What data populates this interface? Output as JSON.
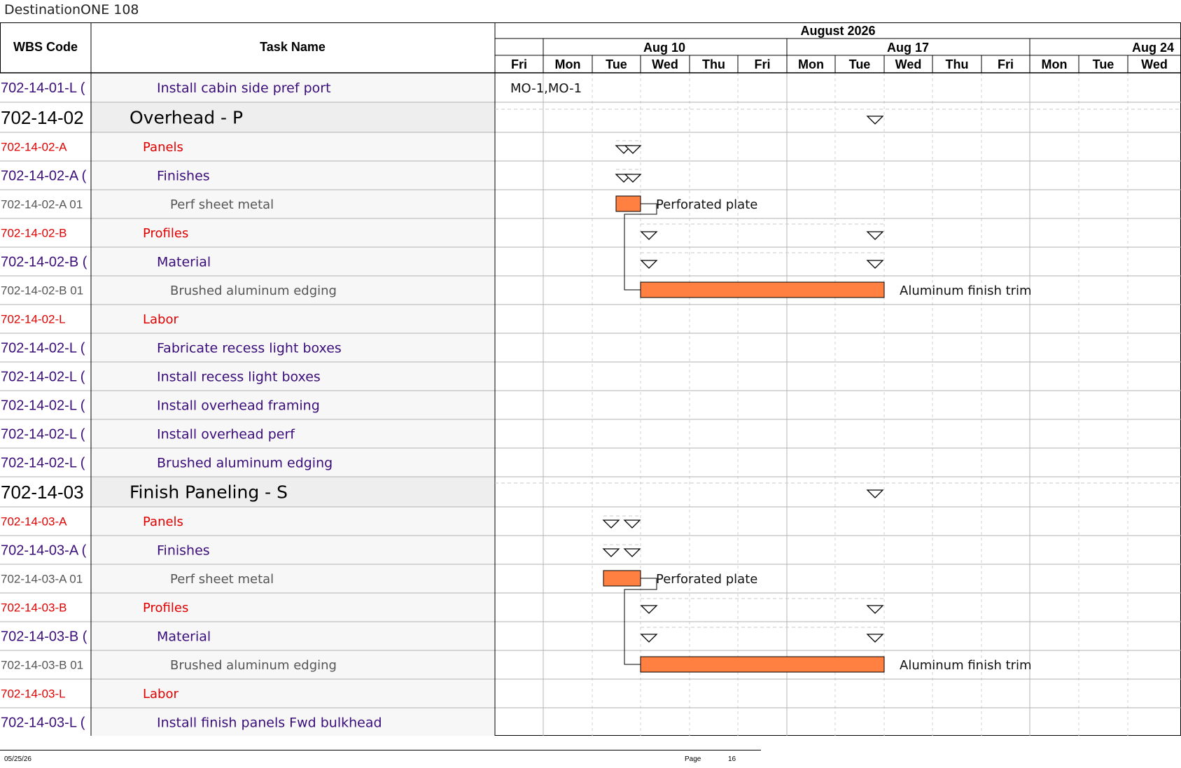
{
  "document": {
    "title": "DestinationONE 108"
  },
  "columns": {
    "wbs_header": "WBS Code",
    "task_header": "Task Name"
  },
  "timescale": {
    "month": "August 2026",
    "weeks": [
      "Aug 10",
      "Aug 17",
      "Aug 24"
    ],
    "days": [
      "Fri",
      "Mon",
      "Tue",
      "Wed",
      "Thu",
      "Fri",
      "Mon",
      "Tue",
      "Wed",
      "Thu",
      "Fri",
      "Mon",
      "Tue",
      "Wed"
    ]
  },
  "rows": [
    {
      "wbs": "702-14-01-L (",
      "name": "Install cabin side pref port",
      "style": "task",
      "label": "MO-1,MO-1"
    },
    {
      "wbs": "702-14-02",
      "name": "Overhead - P",
      "style": "summary"
    },
    {
      "wbs": "702-14-02-A",
      "name": "Panels",
      "style": "group"
    },
    {
      "wbs": "702-14-02-A (",
      "name": "Finishes",
      "style": "task"
    },
    {
      "wbs": "702-14-02-A 01",
      "name": "Perf sheet metal",
      "style": "item",
      "label": "Perforated plate"
    },
    {
      "wbs": "702-14-02-B",
      "name": "Profiles",
      "style": "group"
    },
    {
      "wbs": "702-14-02-B (",
      "name": "Material",
      "style": "task"
    },
    {
      "wbs": "702-14-02-B 01",
      "name": "Brushed aluminum edging",
      "style": "item",
      "label": "Aluminum finish trim"
    },
    {
      "wbs": "702-14-02-L",
      "name": "Labor",
      "style": "group"
    },
    {
      "wbs": "702-14-02-L (",
      "name": "Fabricate recess light boxes",
      "style": "task"
    },
    {
      "wbs": "702-14-02-L (",
      "name": "Install recess light boxes",
      "style": "task"
    },
    {
      "wbs": "702-14-02-L (",
      "name": "Install overhead framing",
      "style": "task"
    },
    {
      "wbs": "702-14-02-L (",
      "name": "Install overhead perf",
      "style": "task"
    },
    {
      "wbs": "702-14-02-L (",
      "name": "Brushed aluminum edging",
      "style": "task"
    },
    {
      "wbs": "702-14-03",
      "name": "Finish Paneling - S",
      "style": "summary"
    },
    {
      "wbs": "702-14-03-A",
      "name": "Panels",
      "style": "group"
    },
    {
      "wbs": "702-14-03-A (",
      "name": "Finishes",
      "style": "task"
    },
    {
      "wbs": "702-14-03-A 01",
      "name": "Perf sheet metal",
      "style": "item",
      "label": "Perforated plate"
    },
    {
      "wbs": "702-14-03-B",
      "name": "Profiles",
      "style": "group"
    },
    {
      "wbs": "702-14-03-B (",
      "name": "Material",
      "style": "task"
    },
    {
      "wbs": "702-14-03-B 01",
      "name": "Brushed aluminum edging",
      "style": "item",
      "label": "Aluminum finish trim"
    },
    {
      "wbs": "702-14-03-L",
      "name": "Labor",
      "style": "group"
    },
    {
      "wbs": "702-14-03-L (",
      "name": "Install finish panels Fwd bulkhead",
      "style": "task"
    }
  ],
  "footer": {
    "date": "05/25/26",
    "page_label": "Page",
    "page_number": "16"
  },
  "colors": {
    "task": "#3a0d7a",
    "group": "#e00000",
    "item": "#555555",
    "summary": "#000000",
    "bar": "#ff8040"
  }
}
